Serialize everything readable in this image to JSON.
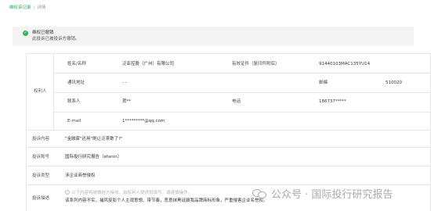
{
  "breadcrumb": {
    "link": "维权诉记录",
    "separator": "/",
    "current": "详情"
  },
  "alert": {
    "status_icon": "check-circle-icon",
    "title": "维权已撤销",
    "description": "此投诉已被投诉方撤销。"
  },
  "rights_holder": {
    "section_label": "权利人",
    "name_label": "姓名/名称",
    "name_value": "泛亚控股（广州）有限公司",
    "id_label": "有效证件（复印件附后）",
    "id_value": "91440103MAC135YU14",
    "address_label": "通讯地址",
    "address_value": "- -",
    "postcode_label": "邮编",
    "postcode_value": "510020",
    "contact_label": "联系人",
    "contact_value": "贺**",
    "phone_label": "电话",
    "phone_value": "186737*****",
    "email_label": "E-mail",
    "email_value": "1*********@qq.com"
  },
  "complaint": {
    "content_label": "投诉内容",
    "content_value": "\"金融家\"还用\"刷让泛茶数了?\"",
    "account_label": "投诉账号",
    "account_value": "国际投行研究报告（efanin）",
    "type_label": "投诉类型",
    "type_value": "涉企业商誉侵权",
    "desc_label": "投诉描述",
    "desc_placeholder": "以下内容将被微信方接收，由权利人提供和填写，请谨慎操作。",
    "desc_value": "该系列内容不实，捕风捉影个人主观意想、带节奏，恶意抹黑诋毁我品牌商标形象，严重侵害企业名誉权。"
  },
  "watermark": {
    "icon": "wechat-icon",
    "text": "公众号 · 国际投行研究报告"
  }
}
